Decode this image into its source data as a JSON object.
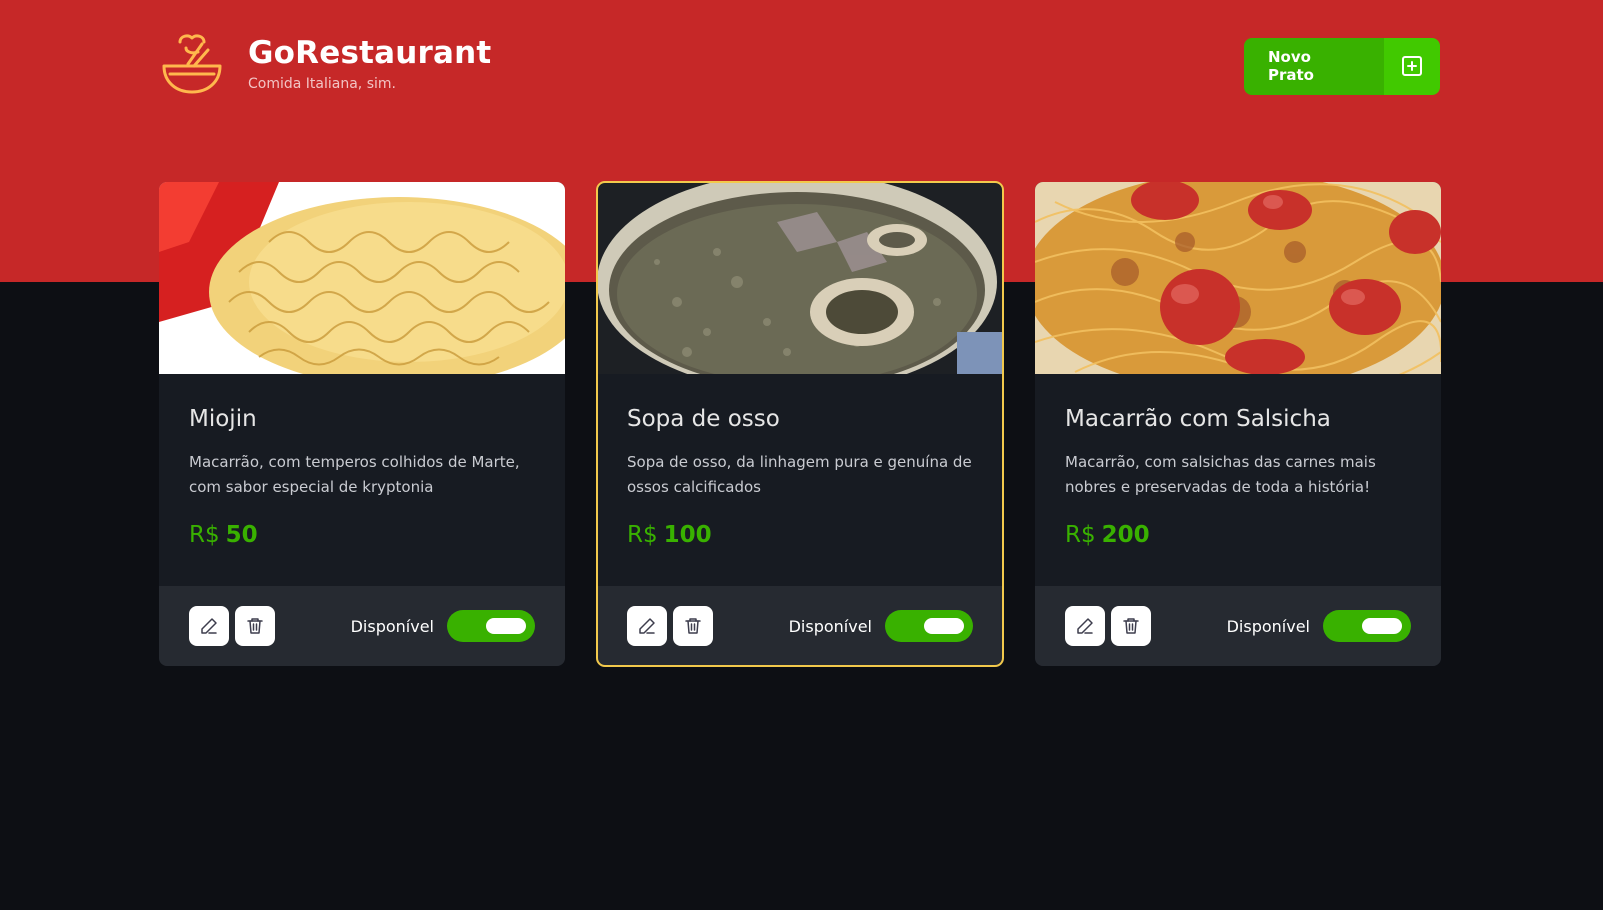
{
  "header": {
    "title": "GoRestaurant",
    "subtitle": "Comida Italiana, sim.",
    "logo_icon": "soup-bowl-icon",
    "new_dish_label": "Novo Prato",
    "new_dish_icon": "plus-square-icon"
  },
  "colors": {
    "header_background": "#c62828",
    "page_background": "#0d0f14",
    "card_background": "#171b22",
    "card_footer_background": "#262a31",
    "accent_green": "#39b100",
    "logo_yellow": "#ffb84d"
  },
  "dishes": [
    {
      "name": "Miojin",
      "description": "Macarrão, com temperos colhidos de Marte, com sabor especial de kryptonia",
      "currency": "R$",
      "price": "50",
      "availability_label": "Disponível",
      "available": true,
      "image_description": "instant-noodles-photo"
    },
    {
      "name": "Sopa de osso",
      "description": "Sopa de osso, da linhagem pura e genuína de ossos calcificados",
      "currency": "R$",
      "price": "100",
      "availability_label": "Disponível",
      "available": true,
      "image_description": "bone-soup-photo"
    },
    {
      "name": "Macarrão com Salsicha",
      "description": "Macarrão, com salsichas das carnes mais nobres e preservadas de toda a história!",
      "currency": "R$",
      "price": "200",
      "availability_label": "Disponível",
      "available": true,
      "image_description": "spaghetti-sausage-photo"
    }
  ]
}
